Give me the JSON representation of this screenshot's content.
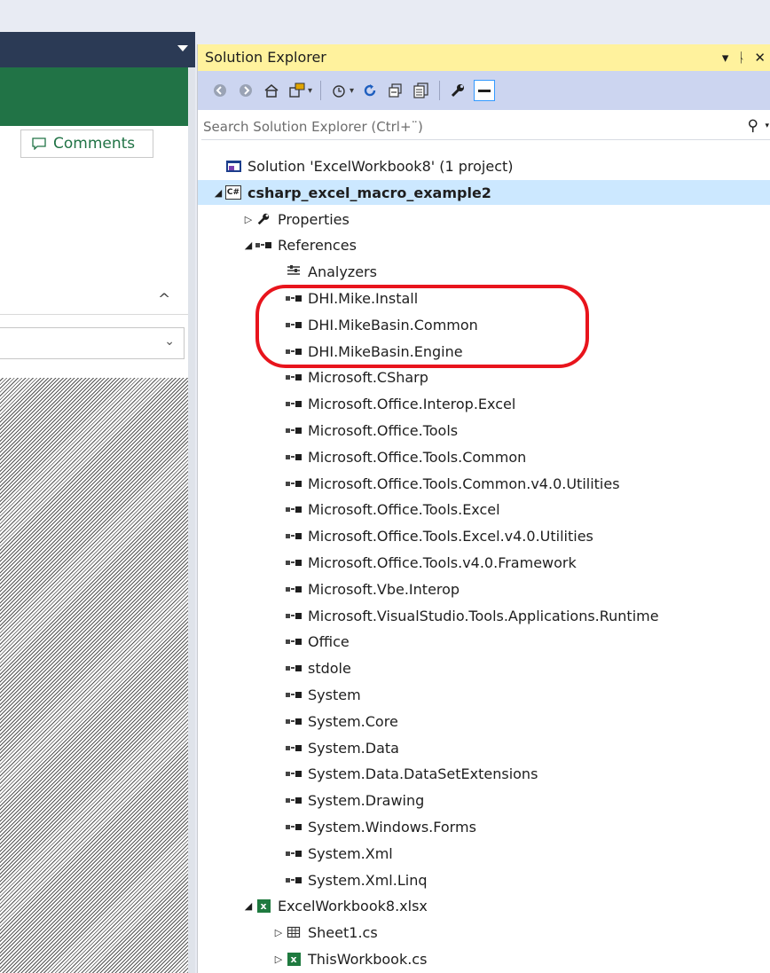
{
  "left_pane": {
    "comments_label": "Comments"
  },
  "solution_explorer": {
    "title": "Solution Explorer",
    "title_tools": {
      "dropdown": "▾",
      "pin": "ᚿ",
      "close": "✕"
    },
    "search": {
      "placeholder": "Search Solution Explorer (Ctrl+¨)"
    },
    "tree": [
      {
        "name": "solution-node",
        "label": "Solution 'ExcelWorkbook8' (1 project)",
        "icon": "solution-icon",
        "indent": 0,
        "expander": ""
      },
      {
        "name": "project-node",
        "label": "csharp_excel_macro_example2",
        "icon": "csharp-project-icon",
        "indent": 0,
        "expander": "expanded",
        "selected": true
      },
      {
        "name": "properties-node",
        "label": "Properties",
        "icon": "wrench-icon",
        "indent": 1,
        "expander": "collapsed"
      },
      {
        "name": "references-node",
        "label": "References",
        "icon": "reference-icon",
        "indent": 1,
        "expander": "expanded"
      },
      {
        "name": "analyzers-node",
        "label": "Analyzers",
        "icon": "analyzer-icon",
        "indent": 2,
        "expander": ""
      },
      {
        "name": "ref-dhi-mike-install",
        "label": "DHI.Mike.Install",
        "icon": "reference-icon",
        "indent": 2,
        "expander": ""
      },
      {
        "name": "ref-dhi-mikebasin-common",
        "label": "DHI.MikeBasin.Common",
        "icon": "reference-icon",
        "indent": 2,
        "expander": ""
      },
      {
        "name": "ref-dhi-mikebasin-engine",
        "label": "DHI.MikeBasin.Engine",
        "icon": "reference-icon",
        "indent": 2,
        "expander": ""
      },
      {
        "name": "ref-microsoft-csharp",
        "label": "Microsoft.CSharp",
        "icon": "reference-icon",
        "indent": 2,
        "expander": ""
      },
      {
        "name": "ref-office-interop-excel",
        "label": "Microsoft.Office.Interop.Excel",
        "icon": "reference-icon",
        "indent": 2,
        "expander": ""
      },
      {
        "name": "ref-office-tools",
        "label": "Microsoft.Office.Tools",
        "icon": "reference-icon",
        "indent": 2,
        "expander": ""
      },
      {
        "name": "ref-office-tools-common",
        "label": "Microsoft.Office.Tools.Common",
        "icon": "reference-icon",
        "indent": 2,
        "expander": ""
      },
      {
        "name": "ref-office-tools-common-utilities",
        "label": "Microsoft.Office.Tools.Common.v4.0.Utilities",
        "icon": "reference-icon",
        "indent": 2,
        "expander": ""
      },
      {
        "name": "ref-office-tools-excel",
        "label": "Microsoft.Office.Tools.Excel",
        "icon": "reference-icon",
        "indent": 2,
        "expander": ""
      },
      {
        "name": "ref-office-tools-excel-utilities",
        "label": "Microsoft.Office.Tools.Excel.v4.0.Utilities",
        "icon": "reference-icon",
        "indent": 2,
        "expander": ""
      },
      {
        "name": "ref-office-tools-framework",
        "label": "Microsoft.Office.Tools.v4.0.Framework",
        "icon": "reference-icon",
        "indent": 2,
        "expander": ""
      },
      {
        "name": "ref-vbe-interop",
        "label": "Microsoft.Vbe.Interop",
        "icon": "reference-icon",
        "indent": 2,
        "expander": ""
      },
      {
        "name": "ref-vs-tools-runtime",
        "label": "Microsoft.VisualStudio.Tools.Applications.Runtime",
        "icon": "reference-icon",
        "indent": 2,
        "expander": ""
      },
      {
        "name": "ref-office",
        "label": "Office",
        "icon": "reference-icon",
        "indent": 2,
        "expander": ""
      },
      {
        "name": "ref-stdole",
        "label": "stdole",
        "icon": "reference-icon",
        "indent": 2,
        "expander": ""
      },
      {
        "name": "ref-system",
        "label": "System",
        "icon": "reference-icon",
        "indent": 2,
        "expander": ""
      },
      {
        "name": "ref-system-core",
        "label": "System.Core",
        "icon": "reference-icon",
        "indent": 2,
        "expander": ""
      },
      {
        "name": "ref-system-data",
        "label": "System.Data",
        "icon": "reference-icon",
        "indent": 2,
        "expander": ""
      },
      {
        "name": "ref-system-data-dataset",
        "label": "System.Data.DataSetExtensions",
        "icon": "reference-icon",
        "indent": 2,
        "expander": ""
      },
      {
        "name": "ref-system-drawing",
        "label": "System.Drawing",
        "icon": "reference-icon",
        "indent": 2,
        "expander": ""
      },
      {
        "name": "ref-system-windows-forms",
        "label": "System.Windows.Forms",
        "icon": "reference-icon",
        "indent": 2,
        "expander": ""
      },
      {
        "name": "ref-system-xml",
        "label": "System.Xml",
        "icon": "reference-icon",
        "indent": 2,
        "expander": ""
      },
      {
        "name": "ref-system-xml-linq",
        "label": "System.Xml.Linq",
        "icon": "reference-icon",
        "indent": 2,
        "expander": ""
      },
      {
        "name": "excel-workbook-node",
        "label": "ExcelWorkbook8.xlsx",
        "icon": "excel-icon",
        "indent": 1,
        "expander": "expanded"
      },
      {
        "name": "sheet1-node",
        "label": "Sheet1.cs",
        "icon": "sheet-icon",
        "indent": 2,
        "expander": "collapsed"
      },
      {
        "name": "thisworkbook-node",
        "label": "ThisWorkbook.cs",
        "icon": "excel-icon",
        "indent": 2,
        "expander": "collapsed"
      }
    ]
  },
  "colors": {
    "title_bar": "#fff29d",
    "toolbar": "#ccd5f0",
    "selection": "#cce8ff",
    "highlight_ellipse": "#e8141c",
    "excel_green": "#217346"
  }
}
